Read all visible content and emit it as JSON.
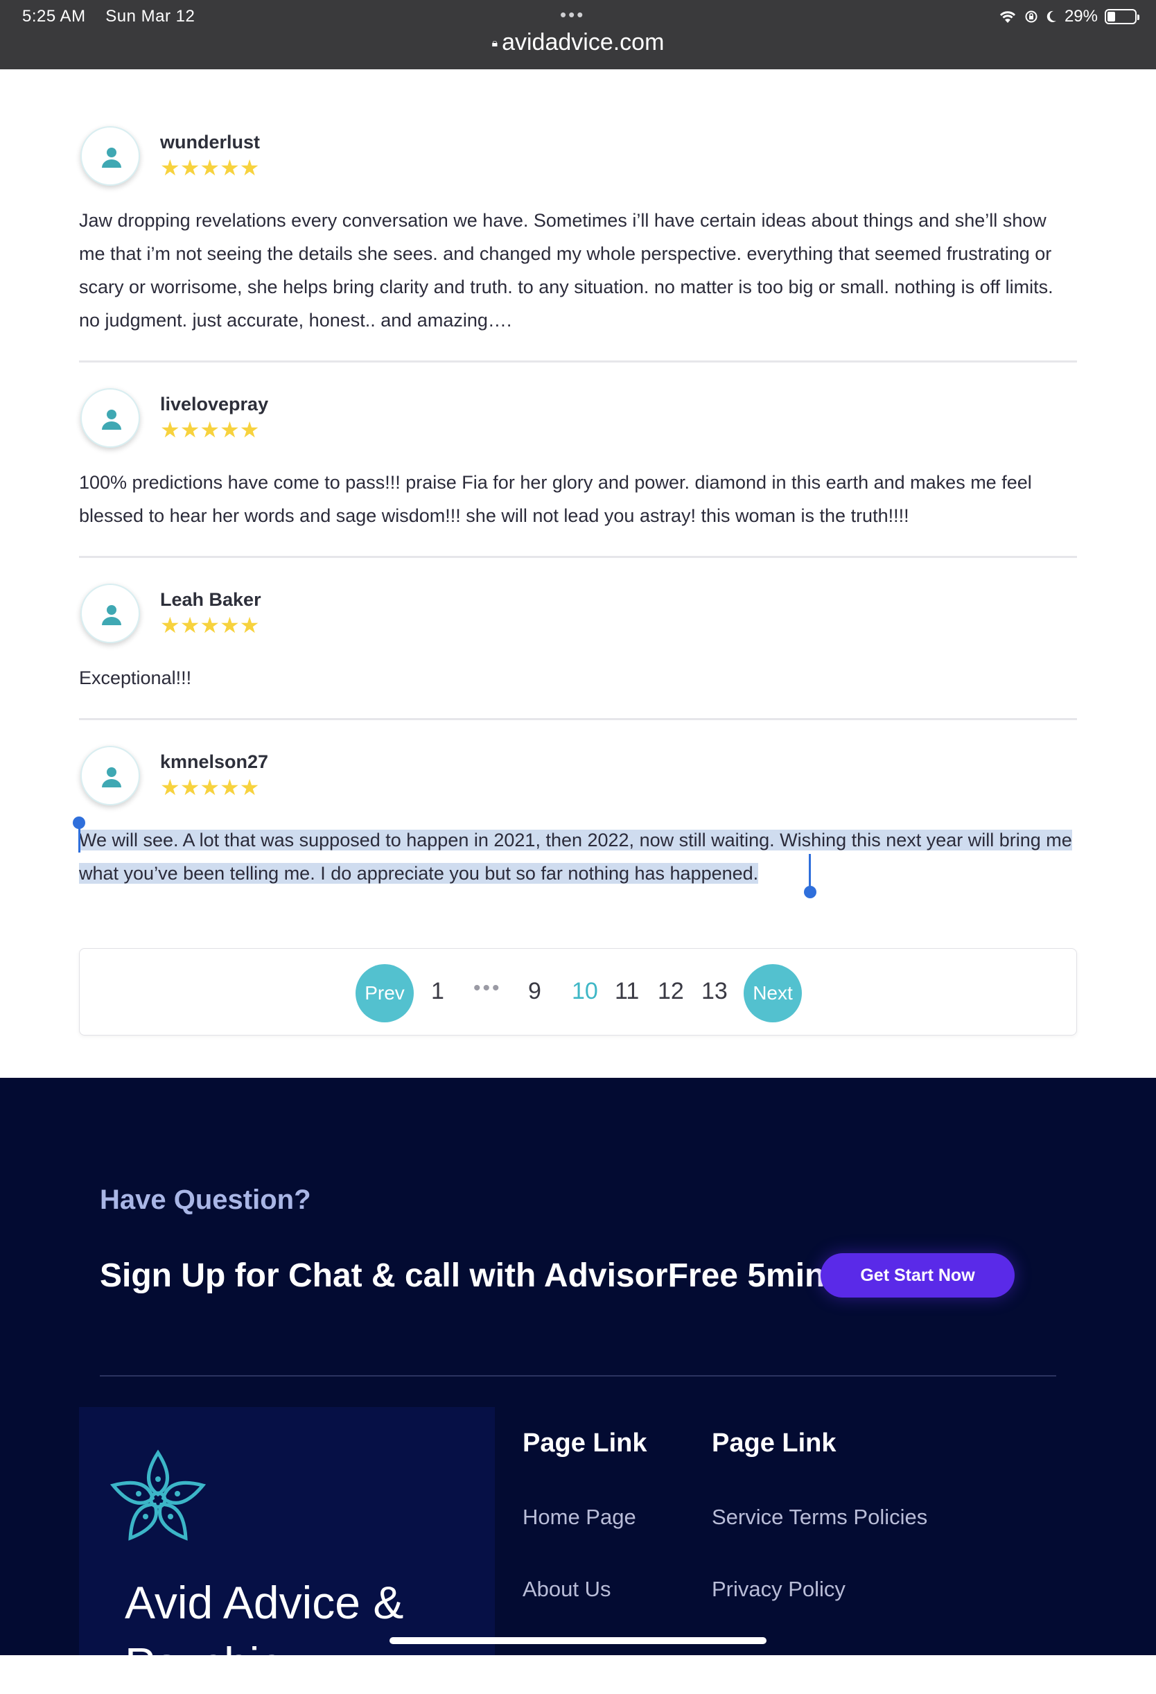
{
  "status_bar": {
    "time": "5:25 AM",
    "date": "Sun Mar 12",
    "url": "avidadvice.com",
    "battery": "29%",
    "battery_level": 0.29
  },
  "reviews": [
    {
      "name": "wunderlust",
      "rating": 5,
      "stars": "★★★★★",
      "text": "Jaw dropping revelations every conversation we have. Sometimes i’ll have certain ideas about things and she’ll show me that i’m not seeing the details she sees. and changed my whole perspective. everything that seemed frustrating or scary or worrisome, she helps bring clarity and truth. to any situation. no matter is too big or small. nothing is off limits. no judgment. just accurate, honest.. and amazing…."
    },
    {
      "name": "livelovepray",
      "rating": 5,
      "stars": "★★★★★",
      "text": "100% predictions have come to pass!!! praise Fia for her glory and power. diamond in this earth and makes me feel blessed to hear her words and sage wisdom!!! she will not lead you astray! this woman is the truth!!!!"
    },
    {
      "name": "Leah Baker",
      "rating": 5,
      "stars": "★★★★★",
      "text": "Exceptional!!!"
    },
    {
      "name": "kmnelson27",
      "rating": 5,
      "stars": "★★★★★",
      "text": "We will see. A lot that was supposed to happen in 2021, then 2022, now still waiting. Wishing this next year will bring me what you’ve been telling me. I do appreciate you but so far nothing has happened."
    }
  ],
  "pagination": {
    "prev": "Prev",
    "next": "Next",
    "pages": [
      "1",
      "9",
      "10",
      "11",
      "12",
      "13"
    ],
    "ellipsis": "•••",
    "current": "10"
  },
  "footer": {
    "question": "Have Question?",
    "signup": "Sign Up for Chat & call with AdvisorFree 5min",
    "cta": "Get Start Now",
    "brand_line1": "Avid Advice &",
    "brand_line2": "Psychic",
    "col1": {
      "title": "Page Link",
      "links": [
        "Home Page",
        "About Us"
      ]
    },
    "col2": {
      "title": "Page Link",
      "links": [
        "Service Terms Policies",
        "Privacy Policy"
      ]
    }
  },
  "colors": {
    "accent": "#53c1cf",
    "star": "#f7d23e",
    "footer_bg": "#030b32",
    "cta": "#5a2ae8",
    "selection": "#cfdcef"
  },
  "icons": [
    "lock-icon",
    "wifi-icon",
    "rotation-lock-icon",
    "moon-icon",
    "battery-icon",
    "user-icon",
    "star-icon",
    "lotus-logo-icon"
  ]
}
